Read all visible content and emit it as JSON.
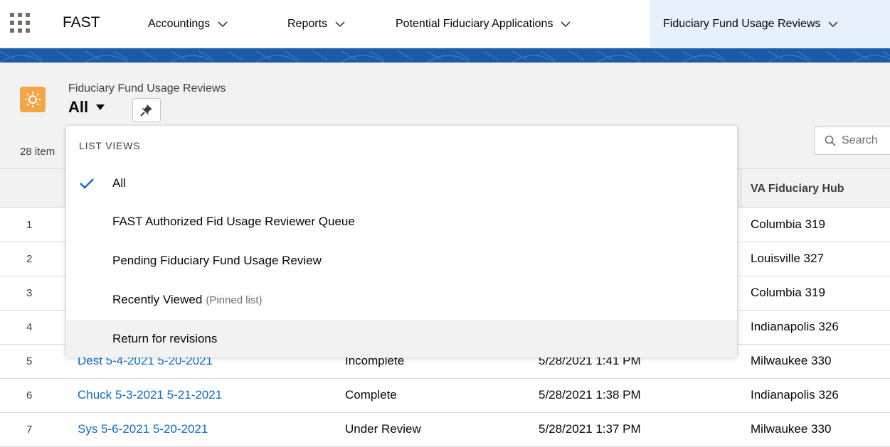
{
  "app": {
    "name": "FAST",
    "nav_items": [
      {
        "label": "Accountings"
      },
      {
        "label": "Reports"
      },
      {
        "label": "Potential Fiduciary Applications"
      },
      {
        "label": "Fiduciary Fund Usage Reviews"
      }
    ]
  },
  "header": {
    "object_label": "Fiduciary Fund Usage Reviews",
    "view_name": "All",
    "item_count": "28 item",
    "search_placeholder": "Search",
    "object_icon": "gear-sun-icon",
    "accent_color": "#f4a646"
  },
  "dropdown": {
    "heading": "LIST VIEWS",
    "items": [
      {
        "label": "All",
        "selected": true,
        "note": ""
      },
      {
        "label": "FAST Authorized Fid Usage Reviewer Queue",
        "selected": false,
        "note": ""
      },
      {
        "label": "Pending Fiduciary Fund Usage Review",
        "selected": false,
        "note": ""
      },
      {
        "label": "Recently Viewed",
        "selected": false,
        "note": "(Pinned list)"
      },
      {
        "label": "Return for revisions",
        "selected": false,
        "note": ""
      }
    ]
  },
  "table": {
    "columns": {
      "hub": "VA Fiduciary Hub"
    },
    "rows": [
      {
        "num": "1",
        "name": "",
        "status": "",
        "date": "",
        "hub": "Columbia 319"
      },
      {
        "num": "2",
        "name": "",
        "status": "",
        "date": "",
        "hub": "Louisville 327"
      },
      {
        "num": "3",
        "name": "",
        "status": "",
        "date": "",
        "hub": "Columbia 319"
      },
      {
        "num": "4",
        "name": "",
        "status": "",
        "date": "",
        "hub": "Indianapolis 326"
      },
      {
        "num": "5",
        "name": "Dest 5-4-2021 5-20-2021",
        "status": "Incomplete",
        "date": "5/28/2021 1:41 PM",
        "hub": "Milwaukee 330"
      },
      {
        "num": "6",
        "name": "Chuck 5-3-2021 5-21-2021",
        "status": "Complete",
        "date": "5/28/2021 1:38 PM",
        "hub": "Indianapolis 326"
      },
      {
        "num": "7",
        "name": "Sys 5-6-2021 5-20-2021",
        "status": "Under Review",
        "date": "5/28/2021 1:37 PM",
        "hub": "Milwaukee 330"
      }
    ]
  },
  "colors": {
    "link": "#0b6bcb",
    "banner": "#1b5aa8",
    "check": "#0b6bcb"
  }
}
